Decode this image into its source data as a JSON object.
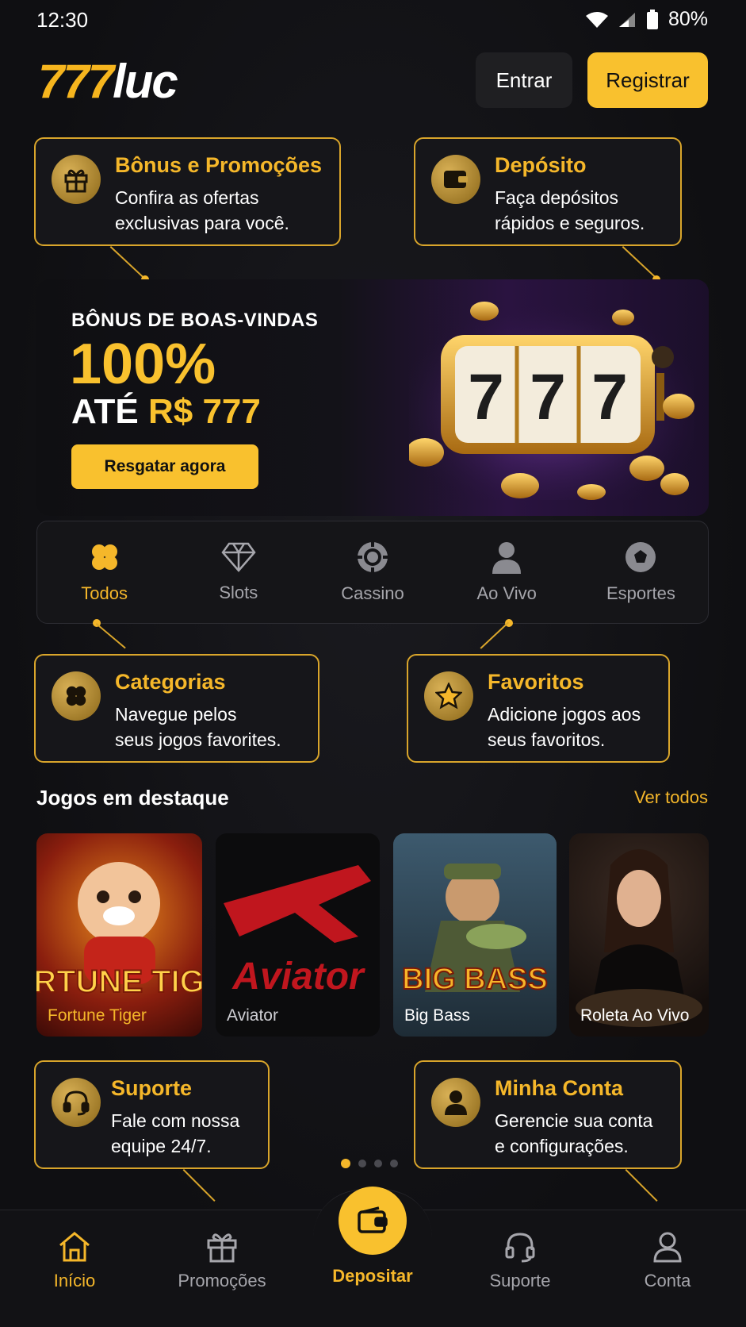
{
  "status": {
    "time": "12:30",
    "battery": "80%"
  },
  "header": {
    "logo_num": "777",
    "logo_txt": "luc",
    "login_label": "Entrar",
    "register_label": "Registrar"
  },
  "tips": {
    "bonus": {
      "title": "Bônus e Promoções",
      "line1": "Confira as ofertas",
      "line2": "exclusivas para você."
    },
    "deposit": {
      "title": "Depósito",
      "line1": "Faça depósitos",
      "line2": "rápidos e seguros."
    },
    "categories": {
      "title": "Categorias",
      "line1": "Navegue pelos",
      "line2": "seus jogos favorites."
    },
    "favorites": {
      "title": "Favoritos",
      "line1": "Adicione jogos aos",
      "line2": "seus favoritos."
    },
    "support": {
      "title": "Suporte",
      "line1": "Fale com nossa",
      "line2": "equipe 24/7."
    },
    "account": {
      "title": "Minha Conta",
      "line1": "Gerencie sua conta",
      "line2": "e configurações."
    }
  },
  "banner": {
    "kicker": "BÔNUS DE BOAS-VINDAS",
    "percent": "100%",
    "ate": "ATÉ",
    "amount": "R$ 777",
    "cta": "Resgatar agora",
    "reel": "7"
  },
  "categories": [
    {
      "label": "Todos",
      "icon": "clover-icon",
      "active": true
    },
    {
      "label": "Slots",
      "icon": "diamond-icon",
      "active": false
    },
    {
      "label": "Cassino",
      "icon": "chip-icon",
      "active": false
    },
    {
      "label": "Ao Vivo",
      "icon": "person-icon",
      "active": false
    },
    {
      "label": "Esportes",
      "icon": "ball-icon",
      "active": false
    }
  ],
  "featured": {
    "title": "Jogos em destaque",
    "see_all": "Ver todos",
    "games": [
      {
        "name": "Fortune Tiger",
        "art_text": "FORTUNE TIGER"
      },
      {
        "name": "Aviator",
        "art_text": "Aviator"
      },
      {
        "name": "Big Bass",
        "art_text": "BIG BASS"
      },
      {
        "name": "Roleta Ao Vivo"
      }
    ]
  },
  "pager": {
    "pages": 4,
    "current": 1
  },
  "bottom_nav": {
    "home": "Início",
    "promos": "Promoções",
    "deposit": "Depositar",
    "support": "Suporte",
    "account": "Conta"
  },
  "colors": {
    "accent": "#f9c12e",
    "gold": "#f5b72a",
    "bg": "#111114"
  }
}
